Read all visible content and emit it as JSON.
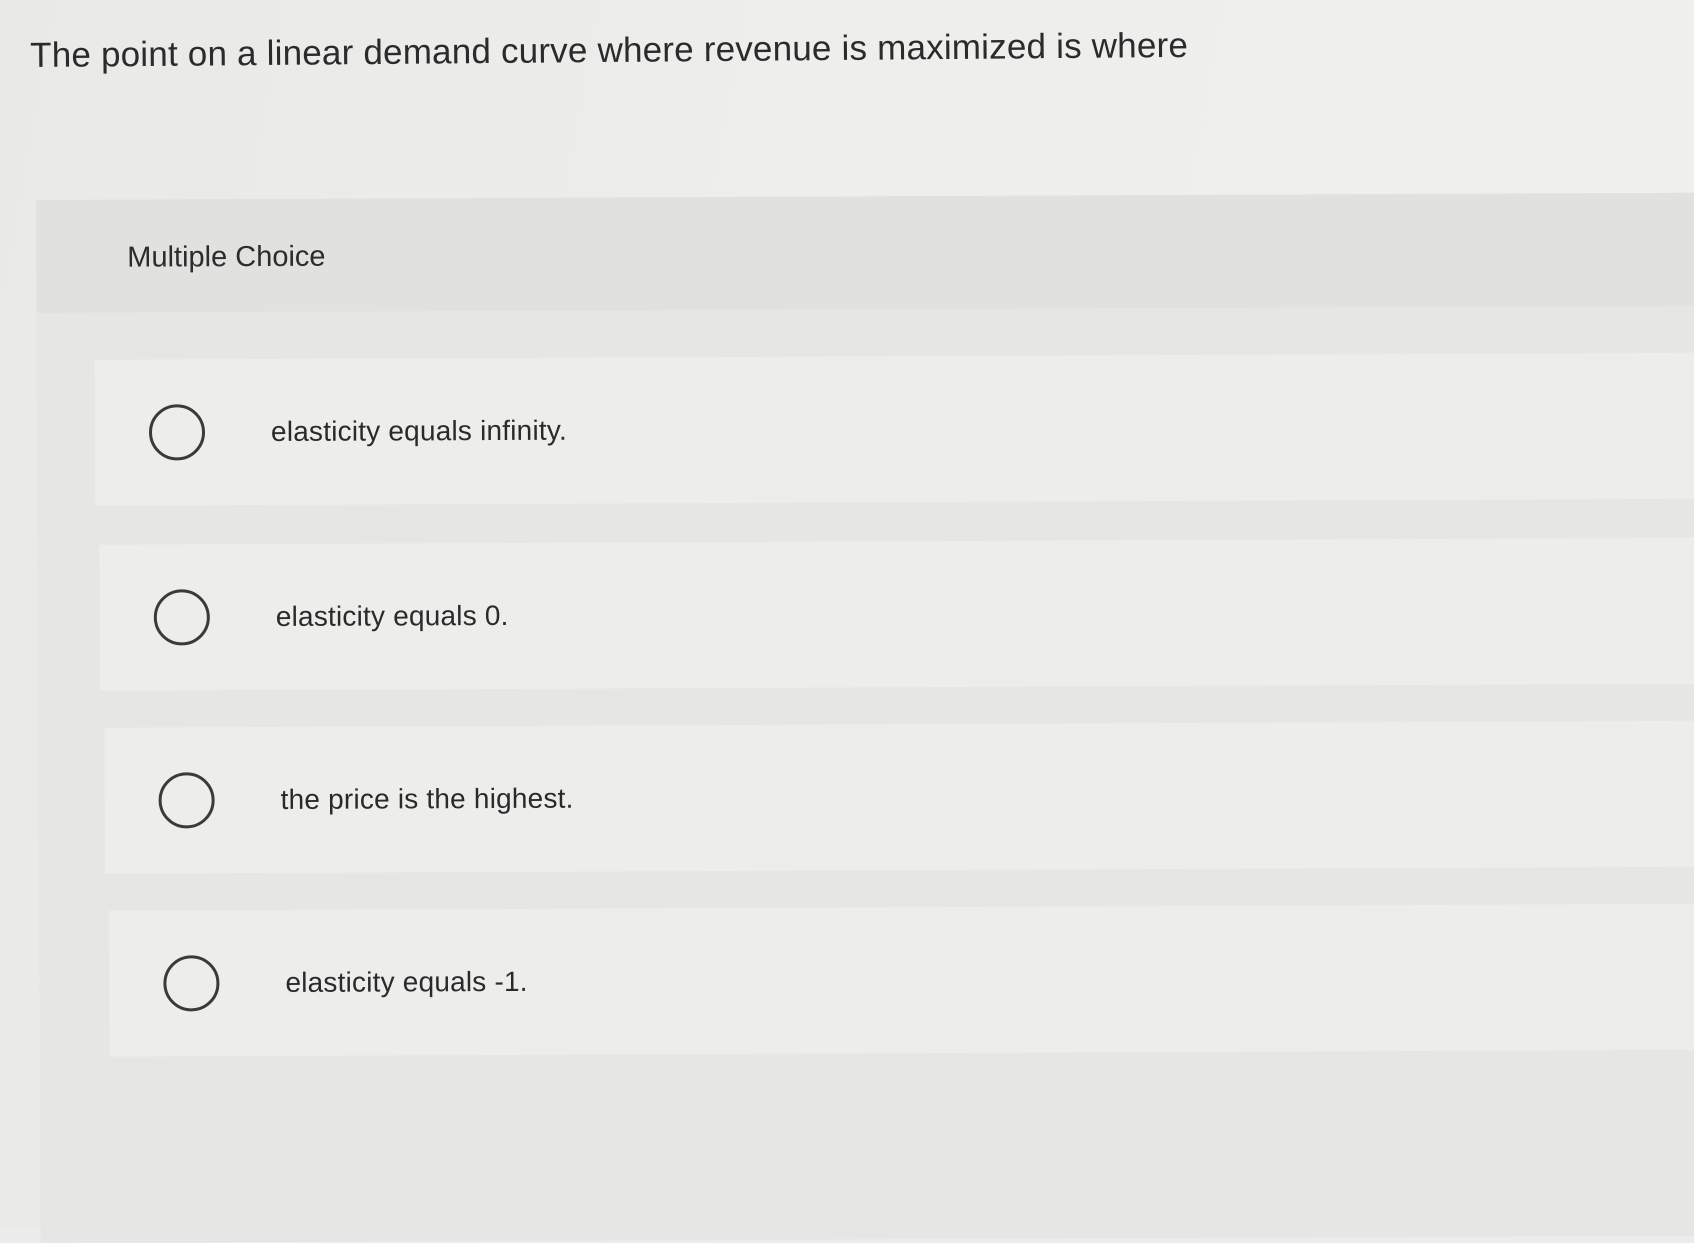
{
  "question": {
    "text": "The point on a linear demand curve where revenue is maximized is where"
  },
  "multiple_choice": {
    "label": "Multiple Choice",
    "options": [
      {
        "label": "elasticity equals infinity.",
        "selected": false
      },
      {
        "label": "elasticity equals 0.",
        "selected": false
      },
      {
        "label": "the price is the highest.",
        "selected": false
      },
      {
        "label": "elasticity equals -1.",
        "selected": false
      }
    ]
  },
  "colors": {
    "background": "#ececea",
    "panel": "#e4e4e2",
    "option_row": "#ededeb",
    "text": "#2a2a2a",
    "radio_border": "#3a3a3a"
  }
}
